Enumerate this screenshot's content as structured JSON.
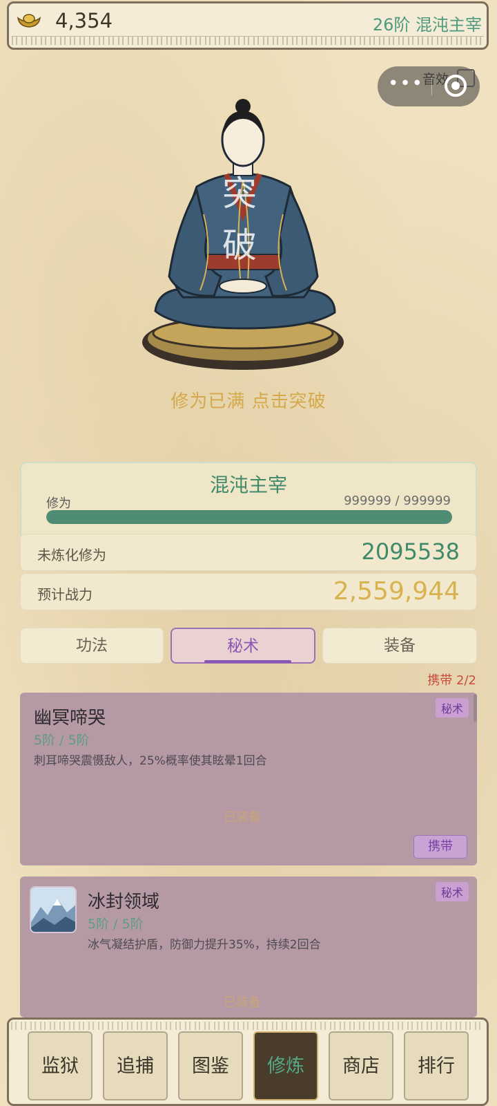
{
  "header": {
    "gold": "4,354",
    "rank": "26阶 混沌主宰"
  },
  "mini_capsule": {
    "sound_label": "音效"
  },
  "center": {
    "breakthrough_char_1": "突",
    "breakthrough_char_2": "破",
    "hint": "修为已满  点击突破"
  },
  "realm": {
    "name": "混沌主宰",
    "xiuwei_label": "修为",
    "xiuwei_value": "999999 / 999999",
    "progress": 1.0
  },
  "stats": {
    "unrefined_label": "未炼化修为",
    "unrefined_value": "2095538",
    "power_label": "预计战力",
    "power_value": "2,559,944"
  },
  "tabs": [
    {
      "label": "功法",
      "active": false
    },
    {
      "label": "秘术",
      "active": true
    },
    {
      "label": "装备",
      "active": false
    }
  ],
  "carry_status": "携带 2/2",
  "skills": [
    {
      "name": "幽冥啼哭",
      "level": "5阶 / 5阶",
      "desc": "刺耳啼哭震慑敌人，25%概率使其眩晕1回合",
      "tag": "秘术",
      "equipped": "已装备",
      "button": "携带"
    },
    {
      "name": "冰封领域",
      "level": "5阶 / 5阶",
      "desc": "冰气凝结护盾，防御力提升35%，持续2回合",
      "tag": "秘术",
      "equipped": "已装备"
    }
  ],
  "nav": [
    {
      "label": "监狱",
      "active": false
    },
    {
      "label": "追捕",
      "active": false
    },
    {
      "label": "图鉴",
      "active": false
    },
    {
      "label": "修炼",
      "active": true
    },
    {
      "label": "商店",
      "active": false
    },
    {
      "label": "排行",
      "active": false
    }
  ],
  "colors": {
    "accent_green": "#4e8c73",
    "gold_text": "#d5a94a",
    "purple": "#8a56b4",
    "card": "#b59aa6"
  }
}
